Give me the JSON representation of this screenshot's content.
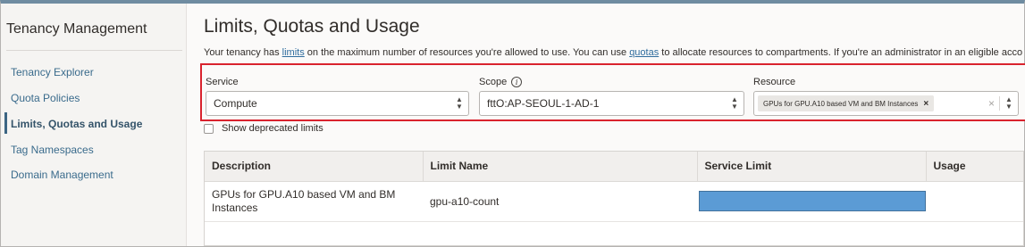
{
  "sidebar": {
    "title": "Tenancy Management",
    "items": [
      {
        "label": "Tenancy Explorer",
        "active": false
      },
      {
        "label": "Quota Policies",
        "active": false
      },
      {
        "label": "Limits, Quotas and Usage",
        "active": true
      },
      {
        "label": "Tag Namespaces",
        "active": false
      },
      {
        "label": "Domain Management",
        "active": false
      }
    ]
  },
  "main": {
    "title": "Limits, Quotas and Usage",
    "intro": {
      "text1": "Your tenancy has ",
      "link1": "limits",
      "text2": " on the maximum number of resources you're allowed to use. You can use ",
      "link2": "quotas",
      "text3": " to allocate resources to compartments. If you're an administrator in an eligible acco"
    },
    "filters": {
      "service": {
        "label": "Service",
        "value": "Compute"
      },
      "scope": {
        "label": "Scope",
        "value": "fttO:AP-SEOUL-1-AD-1",
        "icon": "info-icon"
      },
      "resource": {
        "label": "Resource",
        "tag": "GPUs for GPU.A10 based VM and BM Instances",
        "tag_remove": "×",
        "clear": "×"
      }
    },
    "show_deprecated": {
      "label": "Show deprecated limits",
      "checked": false
    },
    "table": {
      "columns": [
        "Description",
        "Limit Name",
        "Service Limit",
        "Usage"
      ],
      "rows": [
        {
          "description": "GPUs for GPU.A10 based VM and BM Instances",
          "limit_name": "gpu-a10-count",
          "service_limit": "",
          "usage": ""
        }
      ]
    }
  }
}
